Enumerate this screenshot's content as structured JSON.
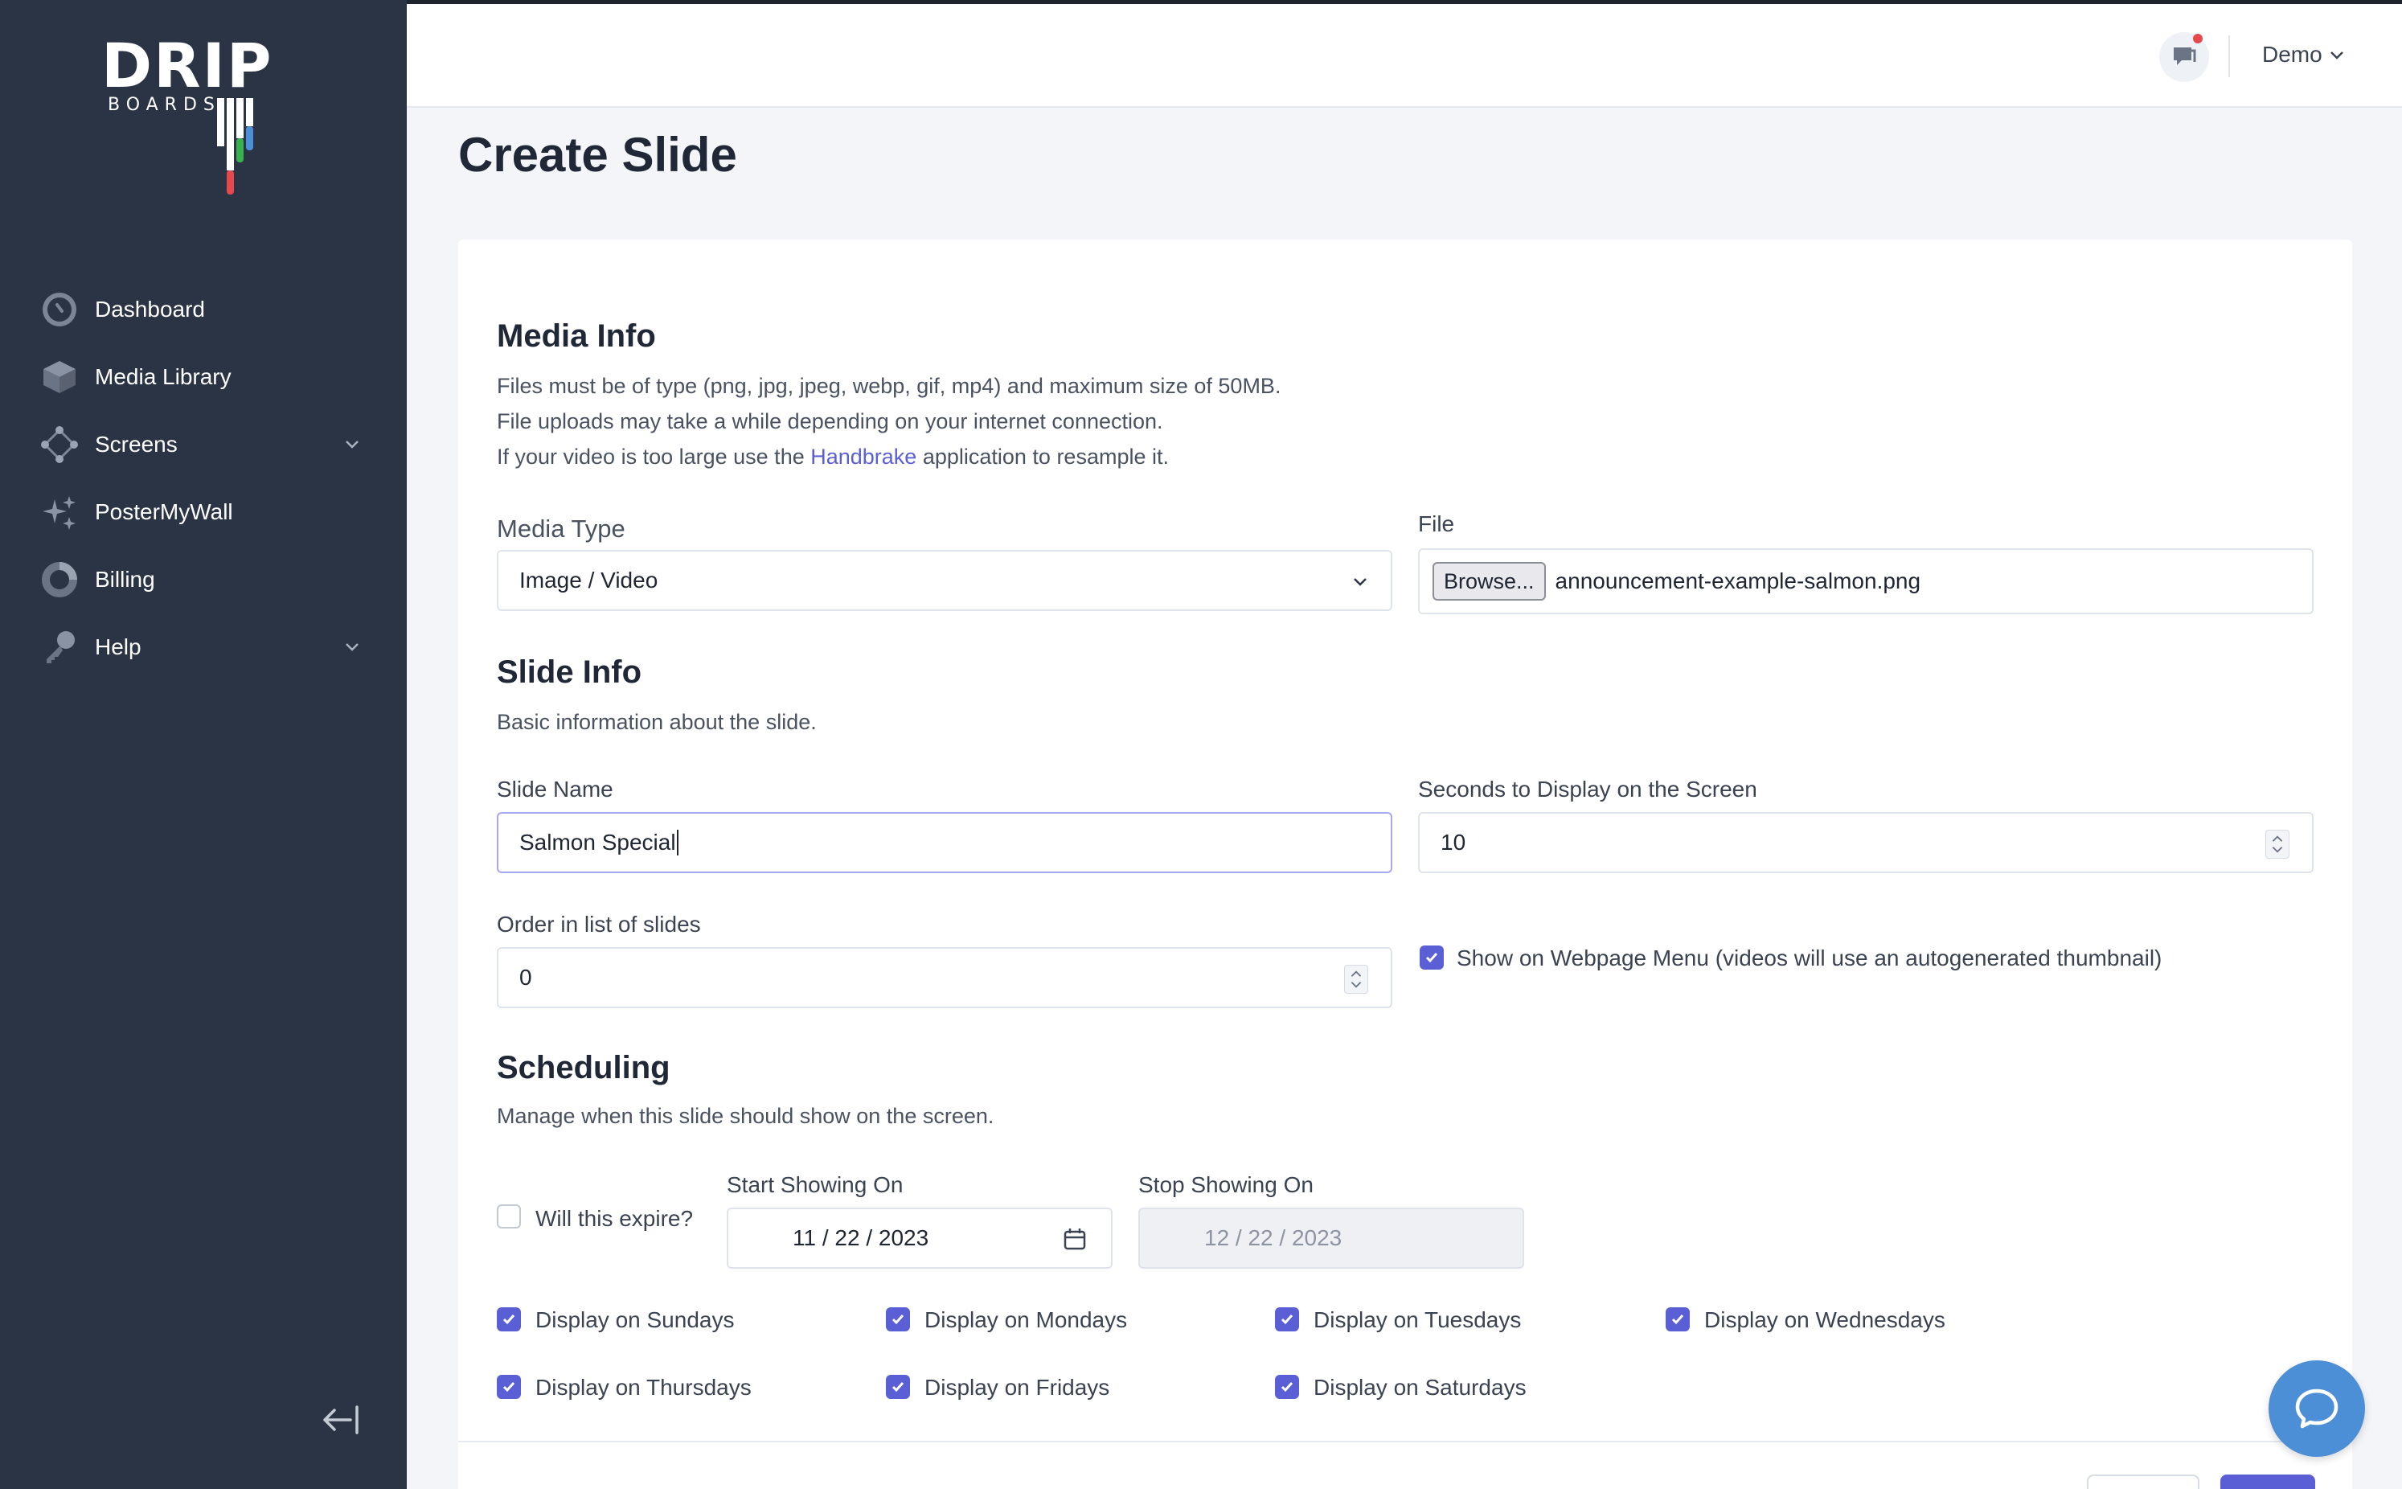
{
  "brand": {
    "word": "DRIP",
    "sub": "BOARDS"
  },
  "sidebar": {
    "items": [
      {
        "label": "Dashboard",
        "icon": "dashboard-gauge-icon",
        "has_children": false
      },
      {
        "label": "Media Library",
        "icon": "cube-icon",
        "has_children": false
      },
      {
        "label": "Screens",
        "icon": "nodes-icon",
        "has_children": true
      },
      {
        "label": "PosterMyWall",
        "icon": "sparkles-icon",
        "has_children": false
      },
      {
        "label": "Billing",
        "icon": "donut-chart-icon",
        "has_children": false
      },
      {
        "label": "Help",
        "icon": "key-icon",
        "has_children": true
      }
    ],
    "collapse_icon": "collapse-left-icon"
  },
  "header": {
    "user_name": "Demo"
  },
  "page": {
    "title": "Create Slide"
  },
  "media_info": {
    "heading": "Media Info",
    "line1": "Files must be of type (png, jpg, jpeg, webp, gif, mp4) and maximum size of 50MB.",
    "line2": "File uploads may take a while depending on your internet connection.",
    "line3_pre": "If your video is too large use the ",
    "line3_link": "Handbrake",
    "line3_post": " application to resample it.",
    "media_type_label": "Media Type",
    "media_type_value": "Image / Video",
    "file_label": "File",
    "browse_label": "Browse...",
    "file_name": "announcement-example-salmon.png"
  },
  "slide_info": {
    "heading": "Slide Info",
    "description": "Basic information about the slide.",
    "name_label": "Slide Name",
    "name_value": "Salmon Special",
    "seconds_label": "Seconds to Display on the Screen",
    "seconds_value": "10",
    "order_label": "Order in list of slides",
    "order_value": "0",
    "show_menu_label": "Show on Webpage Menu (videos will use an autogenerated thumbnail)",
    "show_menu_checked": true
  },
  "scheduling": {
    "heading": "Scheduling",
    "description": "Manage when this slide should show on the screen.",
    "expire_label": "Will this expire?",
    "expire_checked": false,
    "start_label": "Start Showing On",
    "start_value": "11 / 22 / 2023",
    "stop_label": "Stop Showing On",
    "stop_value": "12 / 22 / 2023",
    "days": [
      {
        "label": "Display on Sundays",
        "checked": true
      },
      {
        "label": "Display on Mondays",
        "checked": true
      },
      {
        "label": "Display on Tuesdays",
        "checked": true
      },
      {
        "label": "Display on Wednesdays",
        "checked": true
      },
      {
        "label": "Display on Thursdays",
        "checked": true
      },
      {
        "label": "Display on Fridays",
        "checked": true
      },
      {
        "label": "Display on Saturdays",
        "checked": true
      }
    ]
  },
  "colors": {
    "sidebar": "#2b3444",
    "accent": "#5b5fd6",
    "link": "#5b5fd6",
    "chat": "#4d8fd6",
    "notify": "#e5484d"
  }
}
